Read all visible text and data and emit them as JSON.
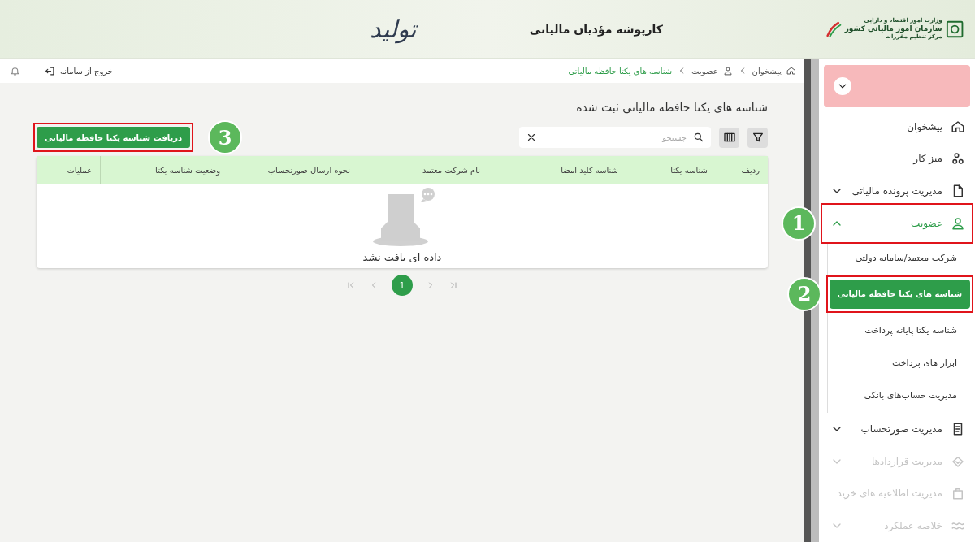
{
  "header": {
    "logo_lines": [
      "وزارت امور اقتصاد و دارایی",
      "سازمان امور مالیاتی کشور",
      "مرکز تنظیم مقررات"
    ],
    "title": "کارپوشه مؤدیان مالیاتی",
    "emblem_text": "تولید"
  },
  "breadcrumb": [
    {
      "label": "پیشخوان",
      "kind": "home"
    },
    {
      "label": "عضویت",
      "kind": "user"
    },
    {
      "label": "شناسه های یکتا حافظه مالیاتی",
      "kind": "current"
    }
  ],
  "logout": {
    "label": "خروج از سامانه"
  },
  "page_title": "شناسه های یکتا حافظه مالیاتی ثبت شده",
  "primary_button": {
    "label": "دریافت شناسه یکتا حافظه مالیاتی"
  },
  "search": {
    "placeholder": "جستجو"
  },
  "table": {
    "columns": [
      "ردیف",
      "شناسه یکتا",
      "شناسه کلید امضا",
      "نام شرکت معتمد",
      "نحوه ارسال صورتحساب",
      "وضعیت شناسه یکتا",
      "عملیات"
    ],
    "empty_text": "داده ای یافت نشد"
  },
  "pagination": {
    "pages": [
      {
        "label": "1",
        "selected": true
      }
    ]
  },
  "sidebar": {
    "items": [
      {
        "label": "پیشخوان",
        "kind": "link",
        "disabled": false
      },
      {
        "label": "میز کار",
        "kind": "link",
        "disabled": false
      },
      {
        "label": "مدیریت پرونده مالیاتی",
        "kind": "group",
        "expanded": false,
        "disabled": false
      },
      {
        "label": "عضویت",
        "kind": "group",
        "expanded": true,
        "disabled": false,
        "children": [
          {
            "label": "شرکت معتمد/سامانه دولتی",
            "selected": false
          },
          {
            "label": "شناسه های یکتا حافظه مالیاتی",
            "selected": true
          },
          {
            "label": "شناسه یکتا پایانه پرداخت",
            "selected": false
          },
          {
            "label": "ابزار های پرداخت",
            "selected": false
          },
          {
            "label": "مدیریت حساب‌های بانکی",
            "selected": false
          }
        ]
      },
      {
        "label": "مدیریت صورتحساب",
        "kind": "group",
        "expanded": false,
        "disabled": false
      },
      {
        "label": "مدیریت قراردادها",
        "kind": "group",
        "expanded": false,
        "disabled": true
      },
      {
        "label": "مدیریت اطلاعیه های خرید",
        "kind": "group",
        "expanded": false,
        "disabled": true
      },
      {
        "label": "خلاصه عملکرد",
        "kind": "group",
        "expanded": false,
        "disabled": true
      }
    ]
  },
  "annotations": [
    {
      "number": "1"
    },
    {
      "number": "2"
    },
    {
      "number": "3"
    }
  ]
}
